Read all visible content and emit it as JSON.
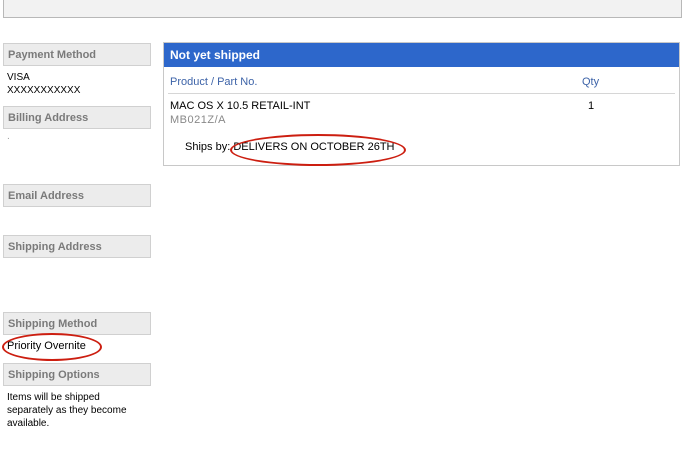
{
  "sidebar": {
    "payment_method": {
      "heading": "Payment Method",
      "lines": [
        "VISA",
        "XXXXXXXXXXX"
      ]
    },
    "billing_address": {
      "heading": "Billing Address",
      "value": "."
    },
    "email_address": {
      "heading": "Email Address"
    },
    "shipping_address": {
      "heading": "Shipping Address"
    },
    "shipping_method": {
      "heading": "Shipping Method",
      "value": "Priority Overnite"
    },
    "shipping_options": {
      "heading": "Shipping Options",
      "lines": [
        "Items will be shipped",
        "separately as they become",
        "available."
      ]
    }
  },
  "order": {
    "status": "Not yet shipped",
    "columns": {
      "product": "Product / Part No.",
      "qty": "Qty"
    },
    "item": {
      "name": "MAC OS X 10.5 RETAIL-INT",
      "part_no": "MB021Z/A",
      "qty": "1"
    },
    "ships_by_label": "Ships by:",
    "ships_by_value": "DELIVERS ON OCTOBER 26TH"
  },
  "annotation_color": "#cc1e10"
}
